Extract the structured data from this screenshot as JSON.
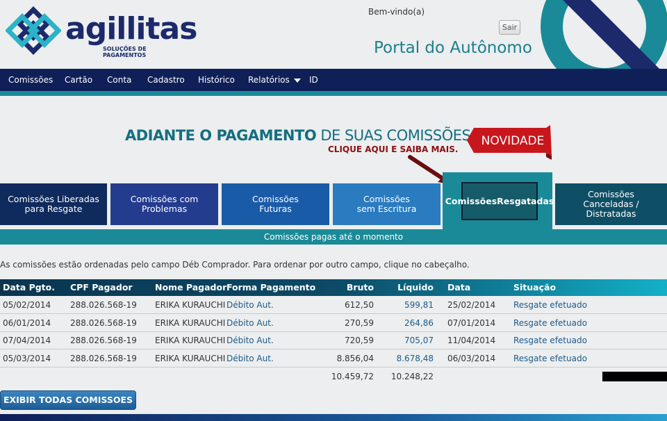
{
  "header": {
    "logo_text": "agillitas",
    "logo_sub": "SOLUÇÕES DE PAGAMENTOS",
    "welcome": "Bem-vindo(a)",
    "logout_label": "Sair",
    "portal_title": "Portal do Autônomo"
  },
  "nav": {
    "items": [
      "Comissões",
      "Cartão",
      "Conta",
      "Cadastro",
      "Histórico",
      "Relatórios",
      "ID"
    ]
  },
  "banner": {
    "main_bold": "ADIANTE O PAGAMENTO",
    "main_rest": " DE SUAS COMISSÕES.",
    "sub": "CLIQUE AQUI E SAIBA MAIS.",
    "badge": "NOVIDADE"
  },
  "tabs": [
    {
      "line1": "Comissões Liberadas",
      "line2": "para Resgate",
      "line3": ""
    },
    {
      "line1": "Comissões com",
      "line2": "Problemas",
      "line3": ""
    },
    {
      "line1": "Comissões",
      "line2": "Futuras",
      "line3": ""
    },
    {
      "line1": "Comissões",
      "line2": "sem Escritura",
      "line3": ""
    },
    {
      "line1": "Comissões",
      "line2": "Resgatadas",
      "line3": ""
    },
    {
      "line1": "Comissões",
      "line2": "Canceladas /",
      "line3": "Distratadas"
    }
  ],
  "sub_bar": "Comissões pagas até o momento",
  "info_text": "As comissões estão ordenadas pelo campo Déb Comprador. Para ordenar por outro campo, clique no cabeçalho.",
  "table": {
    "headers": [
      "Data Pgto.",
      "CPF Pagador",
      "Nome Pagador",
      "Forma Pagamento",
      "Bruto",
      "Líquido",
      "Data",
      "Situação"
    ],
    "rows": [
      [
        "05/02/2014",
        "288.026.568-19",
        "ERIKA KURAUCHI",
        "Débito Aut.",
        "612,50",
        "599,81",
        "25/02/2014",
        "Resgate efetuado"
      ],
      [
        "06/01/2014",
        "288.026.568-19",
        "ERIKA KURAUCHI",
        "Débito Aut.",
        "270,59",
        "264,86",
        "07/01/2014",
        "Resgate efetuado"
      ],
      [
        "07/04/2014",
        "288.026.568-19",
        "ERIKA KURAUCHI",
        "Débito Aut.",
        "720,59",
        "705,07",
        "11/04/2014",
        "Resgate efetuado"
      ],
      [
        "05/03/2014",
        "288.026.568-19",
        "ERIKA KURAUCHI",
        "Débito Aut.",
        "8.856,04",
        "8.678,48",
        "06/03/2014",
        "Resgate efetuado"
      ]
    ],
    "totals": {
      "bruto": "10.459,72",
      "liquido": "10.248,22"
    }
  },
  "show_all_label": "EXIBIR TODAS COMISSOES",
  "colors": {
    "navy": "#0f1f58",
    "teal": "#1a8a98",
    "link": "#1c5a8a",
    "accent_red": "#8c1010"
  }
}
